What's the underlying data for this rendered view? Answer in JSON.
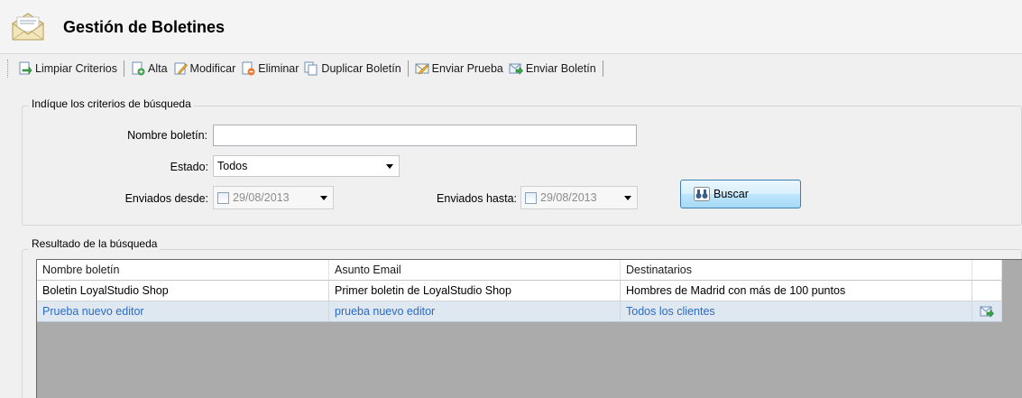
{
  "header": {
    "title": "Gestión de Boletines",
    "icon": "envelope-icon"
  },
  "toolbar": {
    "items": [
      {
        "label": "Limpiar Criterios",
        "icon": "clear-icon"
      },
      {
        "label": "Alta",
        "icon": "add-document-icon"
      },
      {
        "label": "Modificar",
        "icon": "edit-icon"
      },
      {
        "label": "Eliminar",
        "icon": "delete-document-icon"
      },
      {
        "label": "Duplicar Boletín",
        "icon": "duplicate-icon"
      },
      {
        "label": "Enviar Prueba",
        "icon": "test-send-icon"
      },
      {
        "label": "Enviar Boletín",
        "icon": "send-icon"
      }
    ]
  },
  "criteria": {
    "caption": "Indíque los criterios de búsqueda",
    "name_label": "Nombre boletín:",
    "name_value": "",
    "state_label": "Estado:",
    "state_value": "Todos",
    "sent_from_label": "Enviados desde:",
    "sent_from_value": "29/08/2013",
    "sent_to_label": "Enviados hasta:",
    "sent_to_value": "29/08/2013",
    "search_label": "Buscar"
  },
  "results": {
    "caption": "Resultado de la búsqueda",
    "columns": [
      "Nombre boletín",
      "Asunto Email",
      "Destinatarios",
      ""
    ],
    "rows": [
      {
        "name": "Boletin LoyalStudio Shop",
        "subject": "Primer boletin de LoyalStudio Shop",
        "recipients": "Hombres de Madrid con más de 100 puntos",
        "action": ""
      },
      {
        "name": "Prueba nuevo editor",
        "subject": "prueba nuevo editor",
        "recipients": "Todos los clientes",
        "action": "send-icon"
      }
    ]
  },
  "colors": {
    "selected_row_bg": "#dfe7f1",
    "selected_row_text": "#2a6cc4",
    "grid_empty": "#ababab"
  }
}
